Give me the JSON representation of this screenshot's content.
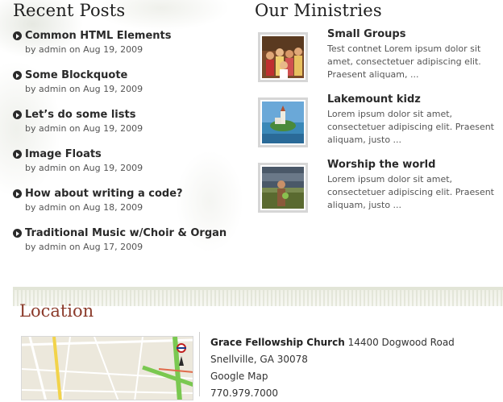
{
  "recent_posts": {
    "title": "Recent Posts",
    "items": [
      {
        "title": "Common HTML Elements",
        "meta": "by admin on Aug 19, 2009"
      },
      {
        "title": "Some Blockquote",
        "meta": "by admin on Aug 19, 2009"
      },
      {
        "title": "Let’s do some lists",
        "meta": "by admin on Aug 19, 2009"
      },
      {
        "title": "Image Floats",
        "meta": "by admin on Aug 19, 2009"
      },
      {
        "title": "How about writing a code?",
        "meta": "by admin on Aug 18, 2009"
      },
      {
        "title": "Traditional Music w/Choir & Organ",
        "meta": "by admin on Aug 17, 2009"
      }
    ]
  },
  "ministries": {
    "title": "Our Ministries",
    "items": [
      {
        "title": "Small Groups",
        "text": "Test contnet Lorem ipsum dolor sit amet, consectetuer adipiscing elit. Praesent aliquam, ..."
      },
      {
        "title": "Lakemount kidz",
        "text": "Lorem ipsum dolor sit amet, consectetuer adipiscing elit. Praesent aliquam, justo ..."
      },
      {
        "title": "Worship the world",
        "text": "Lorem ipsum dolor sit amet, consectetuer adipiscing elit. Praesent aliquam, justo ..."
      }
    ]
  },
  "location": {
    "title": "Location",
    "church_name": "Grace Fellowship Church",
    "address": "14400 Dogwood Road Snellville, GA 30078",
    "map_link": "Google Map",
    "phone": "770.979.7000"
  },
  "colors": {
    "location_heading": "#8b3a2a"
  }
}
